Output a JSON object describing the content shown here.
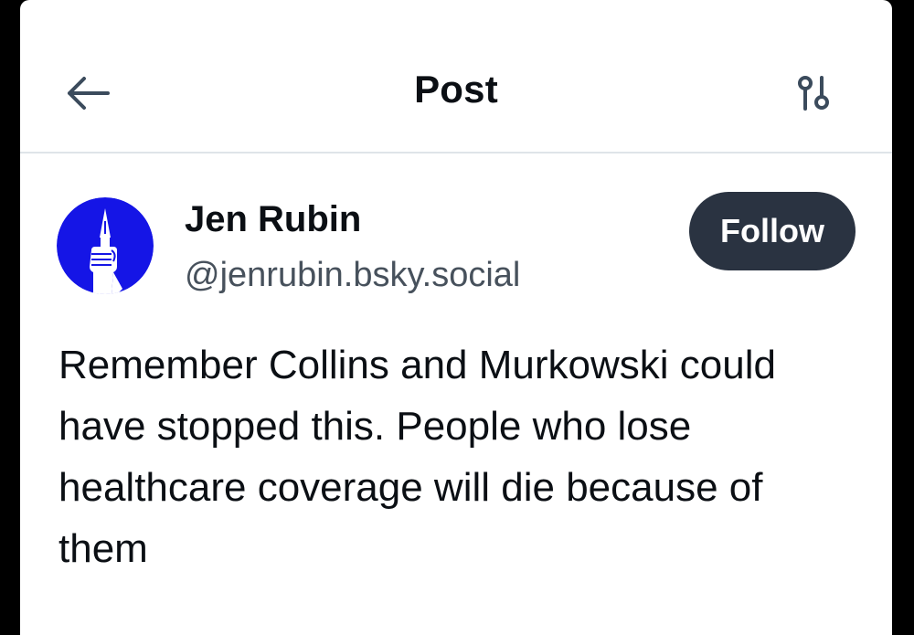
{
  "header": {
    "title": "Post",
    "back_icon": "arrow-left-icon",
    "filter_icon": "sliders-icon"
  },
  "post": {
    "author_name": "Jen Rubin",
    "author_handle": "@jenrubin.bsky.social",
    "follow_label": "Follow",
    "avatar_icon": "raised-fist-with-pen-avatar",
    "text": "Remember Collins and Murkowski could have stopped this. People who lose healthcare coverage will die because of them"
  },
  "colors": {
    "avatar_bg": "#1515e6",
    "follow_bg": "#2a3341",
    "handle_text": "#47515c",
    "icon_color": "#3b4b5c",
    "divider": "#dfe4e9"
  }
}
